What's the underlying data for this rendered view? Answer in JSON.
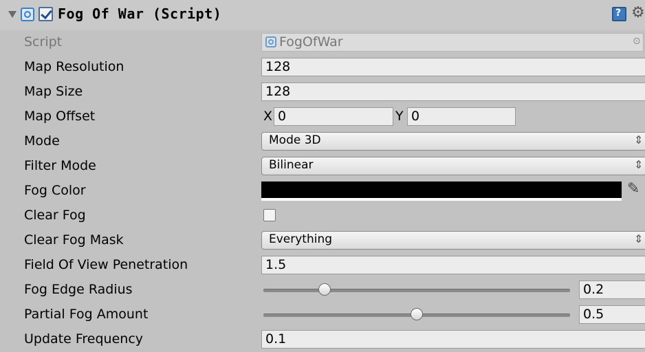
{
  "component": {
    "title": "Fog Of War (Script)",
    "enabled": true
  },
  "properties": {
    "script": {
      "label": "Script",
      "value": "FogOfWar"
    },
    "map_resolution": {
      "label": "Map Resolution",
      "value": "128"
    },
    "map_size": {
      "label": "Map Size",
      "value": "128"
    },
    "map_offset": {
      "label": "Map Offset",
      "x_label": "X",
      "x_value": "0",
      "y_label": "Y",
      "y_value": "0"
    },
    "mode": {
      "label": "Mode",
      "value": "Mode 3D"
    },
    "filter_mode": {
      "label": "Filter Mode",
      "value": "Bilinear"
    },
    "fog_color": {
      "label": "Fog Color",
      "color": "#000000"
    },
    "clear_fog": {
      "label": "Clear Fog",
      "checked": false
    },
    "clear_fog_mask": {
      "label": "Clear Fog Mask",
      "value": "Everything"
    },
    "field_of_view_penetration": {
      "label": "Field Of View Penetration",
      "value": "1.5"
    },
    "fog_edge_radius": {
      "label": "Fog Edge Radius",
      "value": "0.2",
      "slider_fraction": 0.2
    },
    "partial_fog_amount": {
      "label": "Partial Fog Amount",
      "value": "0.5",
      "slider_fraction": 0.5
    },
    "update_frequency": {
      "label": "Update Frequency",
      "value": "0.1"
    }
  },
  "icons": {
    "foldout": "triangle-down-icon",
    "script": "script-icon",
    "help": "help-icon",
    "settings": "gear-icon",
    "object_picker": "object-picker-icon",
    "dropdown": "dropdown-arrow-icon",
    "eyedropper": "eyedropper-icon"
  },
  "colors": {
    "panel_bg": "#c2c2c2",
    "header_bg": "#c9c9c9",
    "field_bg": "#ececec",
    "accent": "#3f7bbd"
  }
}
